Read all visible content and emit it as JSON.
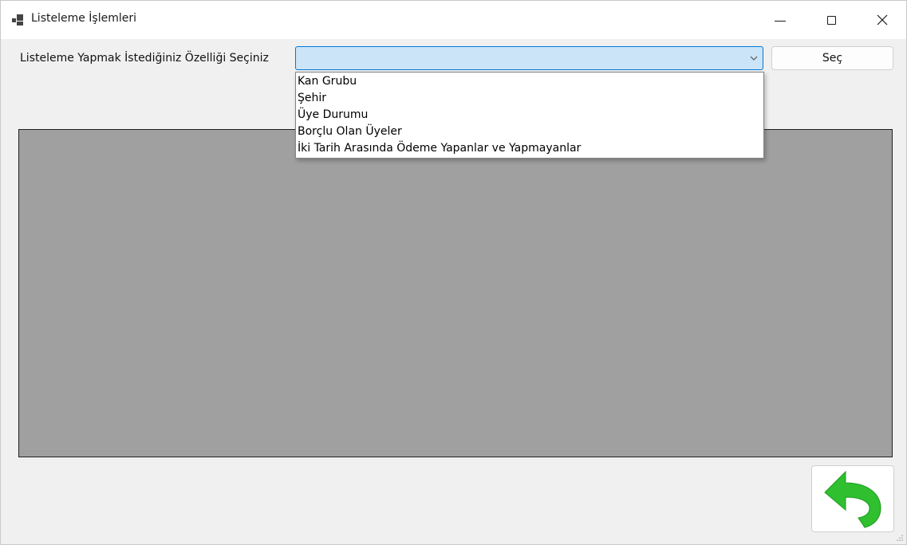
{
  "window": {
    "title": "Listeleme İşlemleri",
    "controls": {
      "minimize_icon": "minimize-icon",
      "maximize_icon": "maximize-icon",
      "close_icon": "close-icon"
    }
  },
  "form": {
    "prompt_label": "Listeleme Yapmak İstediğiniz Özelliği Seçiniz",
    "combo_value": "",
    "select_button_label": "Seç",
    "dropdown_options": [
      "Kan Grubu",
      "Şehir",
      "Üye Durumu",
      "Borçlu Olan Üyeler",
      "İki Tarih Arasında Ödeme Yapanlar ve Yapmayanlar"
    ]
  },
  "back_button": {
    "icon": "back-arrow-icon"
  },
  "colors": {
    "combo_focus_border": "#0078d7",
    "combo_focus_fill": "#cce4f7",
    "grid_background": "#a0a0a0",
    "back_arrow_green": "#2fbf2f"
  }
}
